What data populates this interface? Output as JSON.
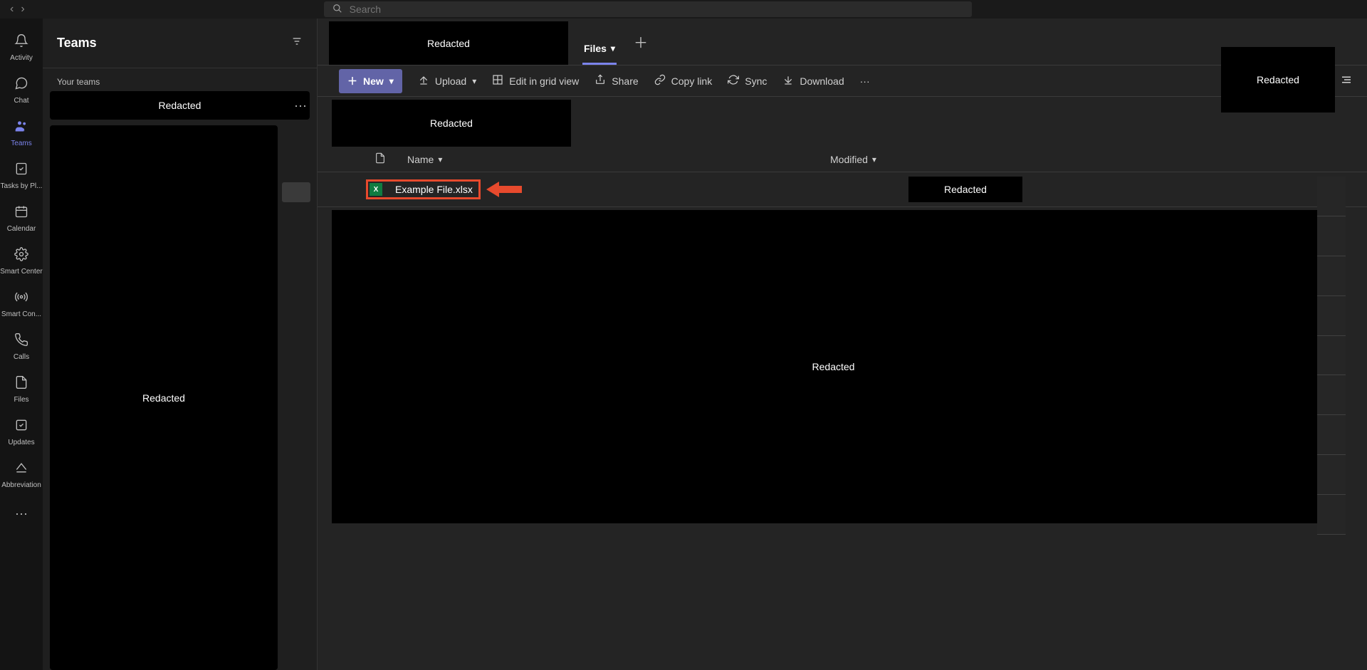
{
  "search": {
    "placeholder": "Search"
  },
  "apprail": {
    "items": [
      {
        "label": "Activity"
      },
      {
        "label": "Chat"
      },
      {
        "label": "Teams"
      },
      {
        "label": "Tasks by Pl..."
      },
      {
        "label": "Calendar"
      },
      {
        "label": "Smart Center"
      },
      {
        "label": "Smart Con..."
      },
      {
        "label": "Calls"
      },
      {
        "label": "Files"
      },
      {
        "label": "Updates"
      },
      {
        "label": "Abbreviation"
      }
    ]
  },
  "sidebar": {
    "title": "Teams",
    "section_label": "Your teams",
    "team_label": "Redacted",
    "channels_label": "Redacted"
  },
  "tabs": {
    "channel_title": "Redacted",
    "files_label": "Files"
  },
  "toolbar": {
    "new_label": "New",
    "upload_label": "Upload",
    "grid_label": "Edit in grid view",
    "share_label": "Share",
    "copy_label": "Copy link",
    "sync_label": "Sync",
    "download_label": "Download"
  },
  "folder": {
    "name": "Redacted"
  },
  "columns": {
    "name": "Name",
    "modified": "Modified"
  },
  "file": {
    "name": "Example File.xlsx",
    "modified_label": "Redacted"
  },
  "redacted": {
    "right_block": "Redacted",
    "big_block": "Redacted"
  }
}
